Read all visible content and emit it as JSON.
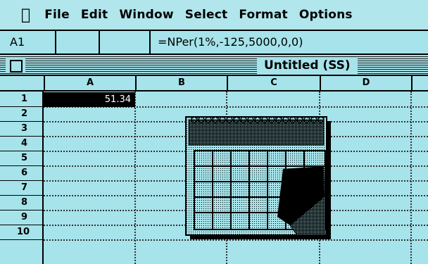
{
  "menubar": {
    "apple": "",
    "items": [
      "File",
      "Edit",
      "Window",
      "Select",
      "Format",
      "Options"
    ]
  },
  "formula_bar": {
    "cell_ref": "A1",
    "formula": "=NPer(1%,-125,5000,0,0)"
  },
  "window": {
    "title": "Untitled (SS)"
  },
  "grid": {
    "columns": [
      "A",
      "B",
      "C",
      "D"
    ],
    "rows": [
      "1",
      "2",
      "3",
      "4",
      "5",
      "6",
      "7",
      "8",
      "9",
      "10"
    ],
    "cells": {
      "A1": "51.34"
    }
  },
  "colors": {
    "background": "#a6e3ea",
    "active_cell": "#000000"
  },
  "icons": {
    "apple_menu": "apple-icon",
    "close_box": "close-box-icon",
    "overlay": "calendar-icon"
  }
}
